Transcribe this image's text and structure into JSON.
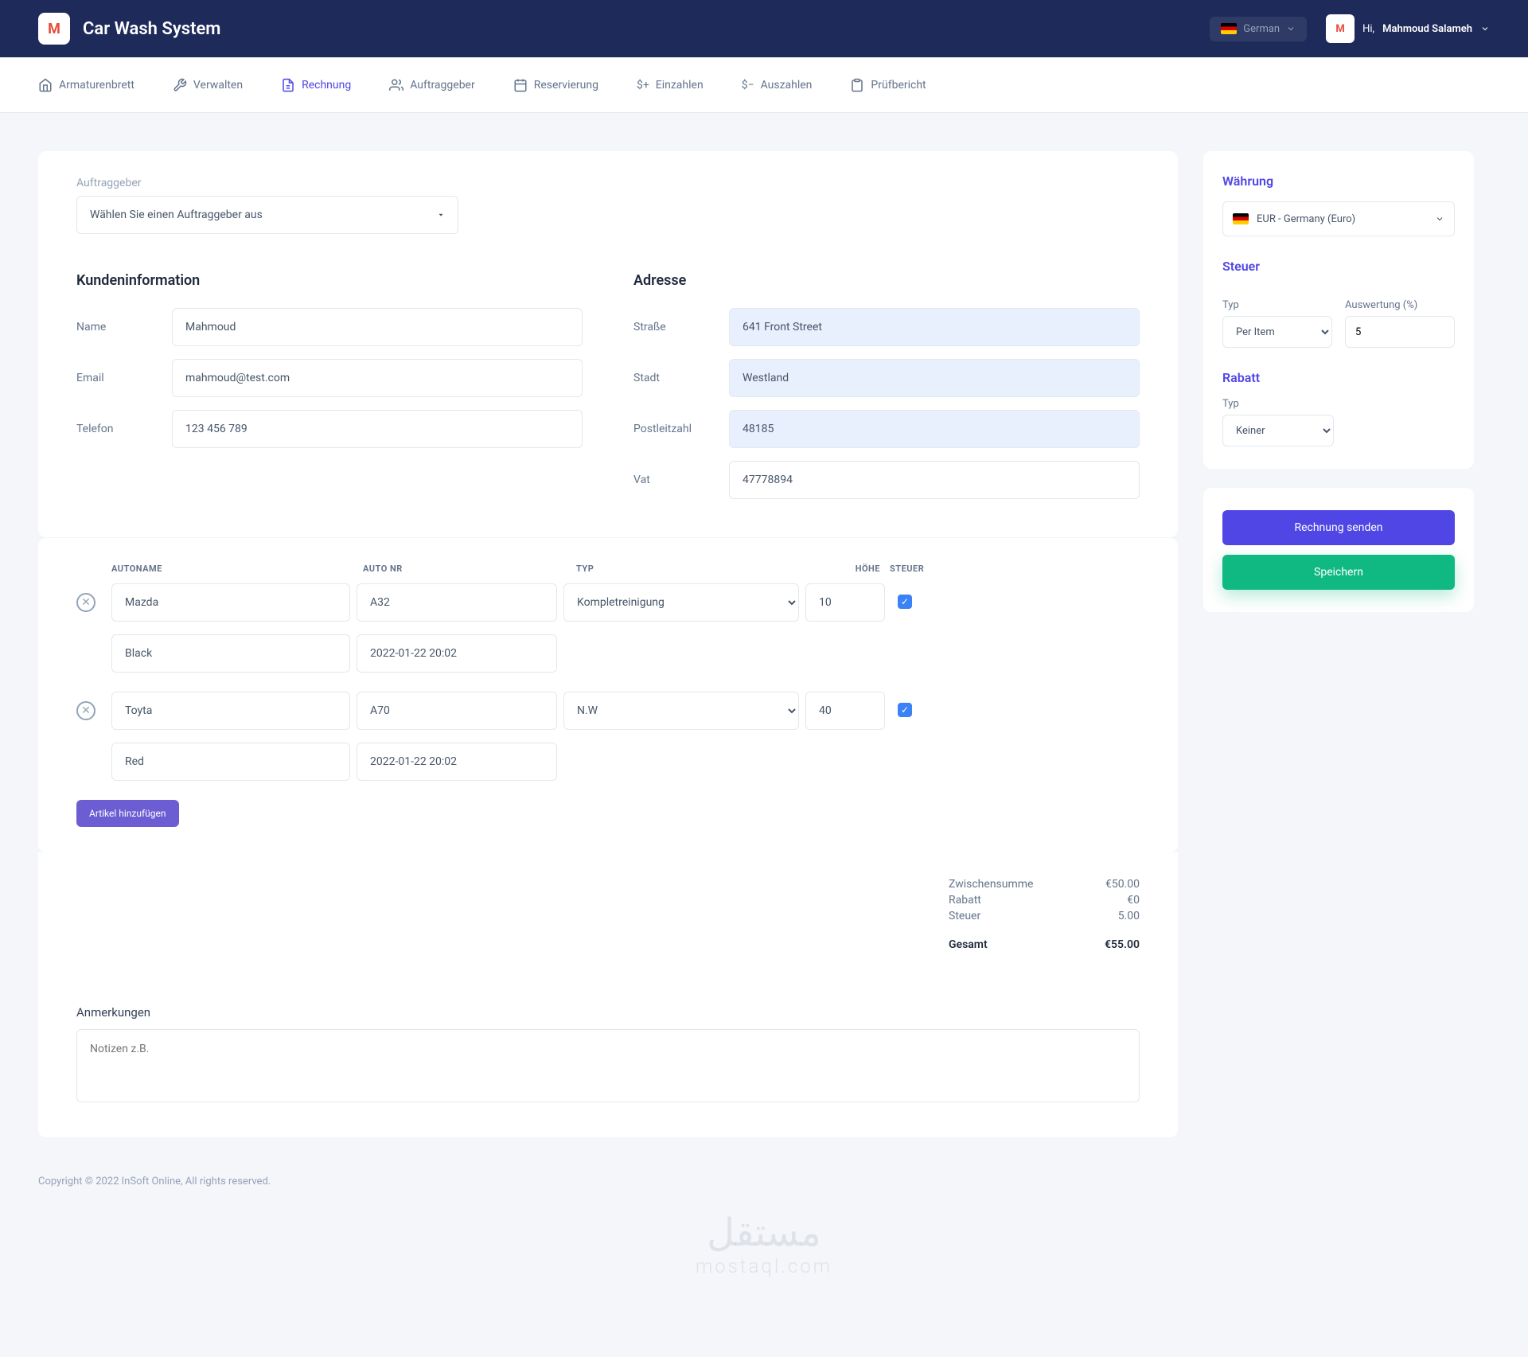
{
  "header": {
    "app_title": "Car Wash System",
    "logo_letter": "M",
    "language": "German",
    "user_greeting": "Hi,",
    "user_name": "Mahmoud Salameh"
  },
  "nav": {
    "items": [
      {
        "label": "Armaturenbrett",
        "icon": "home"
      },
      {
        "label": "Verwalten",
        "icon": "wrench"
      },
      {
        "label": "Rechnung",
        "icon": "file"
      },
      {
        "label": "Auftraggeber",
        "icon": "users"
      },
      {
        "label": "Reservierung",
        "icon": "calendar"
      },
      {
        "label": "Einzahlen",
        "icon": "dollar-plus"
      },
      {
        "label": "Auszahlen",
        "icon": "dollar-minus"
      },
      {
        "label": "Prüfbericht",
        "icon": "clipboard"
      }
    ]
  },
  "main": {
    "client_label": "Auftraggeber",
    "client_select": "Wählen Sie einen Auftraggeber aus",
    "customer_info_title": "Kundeninformation",
    "address_title": "Adresse",
    "fields": {
      "name_label": "Name",
      "name_value": "Mahmoud",
      "email_label": "Email",
      "email_value": "mahmoud@test.com",
      "phone_label": "Telefon",
      "phone_value": "123 456 789",
      "street_label": "Straße",
      "street_value": "641 Front Street",
      "city_label": "Stadt",
      "city_value": "Westland",
      "postal_label": "Postleitzahl",
      "postal_value": "48185",
      "vat_label": "Vat",
      "vat_value": "47778894"
    }
  },
  "items": {
    "headers": {
      "name": "AUTONAME",
      "nr": "AUTO NR",
      "typ": "TYP",
      "hohe": "HÖHE",
      "steuer": "STEUER"
    },
    "rows": [
      {
        "name": "Mazda",
        "nr": "A32",
        "typ": "Kompletreinigung",
        "hohe": "10",
        "color": "Black",
        "date": "2022-01-22 20:02",
        "tax": true
      },
      {
        "name": "Toyta",
        "nr": "A70",
        "typ": "N.W",
        "hohe": "40",
        "color": "Red",
        "date": "2022-01-22 20:02",
        "tax": true
      }
    ],
    "add_label": "Artikel hinzufügen"
  },
  "totals": {
    "subtotal_label": "Zwischensumme",
    "subtotal_value": "€50.00",
    "discount_label": "Rabatt",
    "discount_value": "€0",
    "tax_label": "Steuer",
    "tax_value": "5.00",
    "grand_label": "Gesamt",
    "grand_value": "€55.00"
  },
  "notes": {
    "title": "Anmerkungen",
    "placeholder": "Notizen z.B."
  },
  "side": {
    "currency_title": "Währung",
    "currency_value": "EUR - Germany (Euro)",
    "tax_title": "Steuer",
    "tax_type_label": "Typ",
    "tax_type_value": "Per Item",
    "tax_eval_label": "Auswertung (%)",
    "tax_eval_value": "5",
    "discount_title": "Rabatt",
    "discount_type_label": "Typ",
    "discount_type_value": "Keiner",
    "send_label": "Rechnung senden",
    "save_label": "Speichern"
  },
  "footer": "Copyright © 2022 InSoft Online, All rights reserved.",
  "watermark": {
    "main": "مستقل",
    "sub": "mostaql.com"
  }
}
